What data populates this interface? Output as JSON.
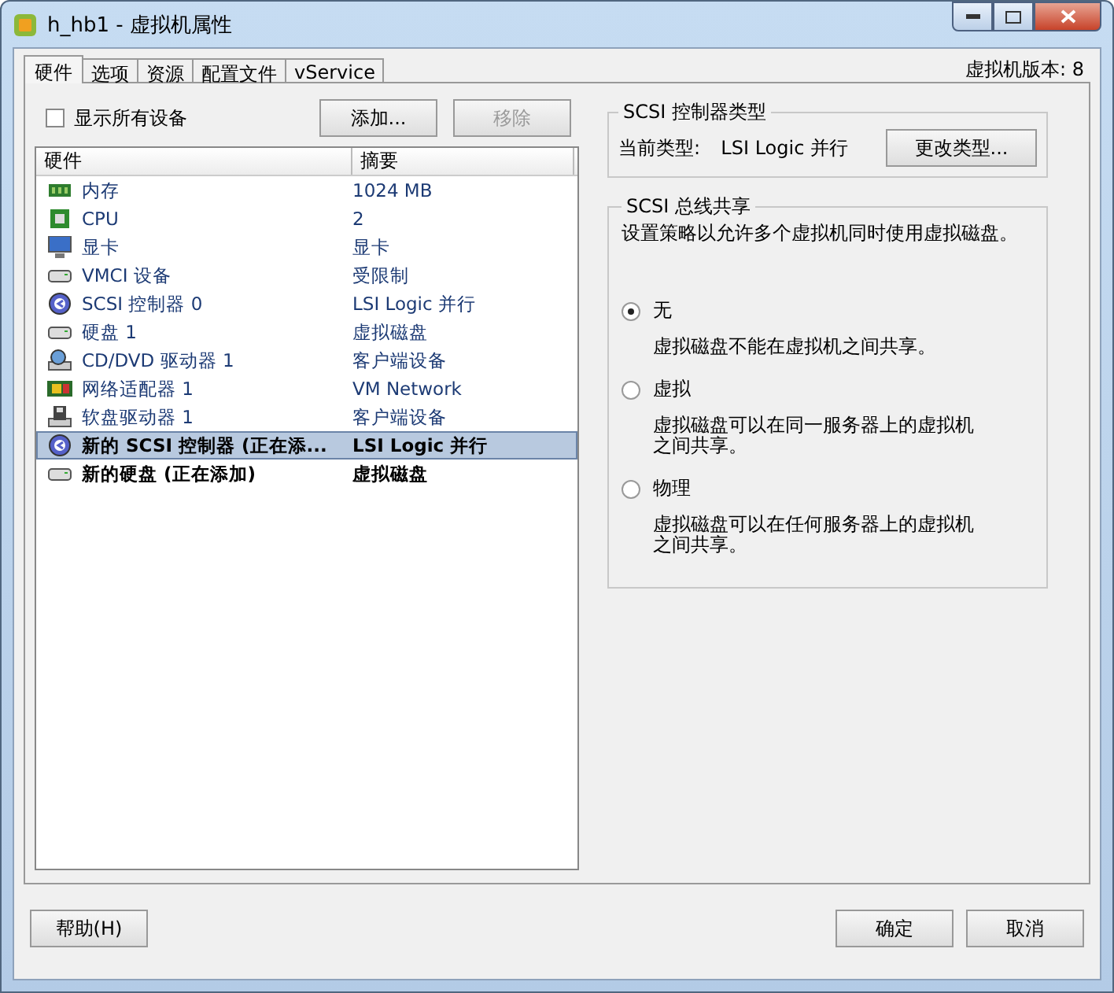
{
  "window": {
    "title": "h_hb1 - 虚拟机属性"
  },
  "tabs": [
    {
      "label": "硬件",
      "selected": true
    },
    {
      "label": "选项",
      "selected": false
    },
    {
      "label": "资源",
      "selected": false
    },
    {
      "label": "配置文件",
      "selected": false
    },
    {
      "label": "vService",
      "selected": false
    }
  ],
  "vm_version": "虚拟机版本: 8",
  "show_all": {
    "label": "显示所有设备",
    "checked": false
  },
  "add_button": {
    "label": "添加...",
    "disabled": false
  },
  "remove_button": {
    "label": "移除",
    "disabled": true
  },
  "table": {
    "columns": [
      "硬件",
      "摘要"
    ],
    "rows": [
      {
        "kind": "memory",
        "name": "内存",
        "summary": "1024 MB",
        "selected": false,
        "pending": false
      },
      {
        "kind": "cpu",
        "name": "CPU",
        "summary": "2",
        "selected": false,
        "pending": false
      },
      {
        "kind": "display",
        "name": "显卡",
        "summary": "显卡",
        "selected": false,
        "pending": false
      },
      {
        "kind": "device",
        "name": "VMCI 设备",
        "summary": "受限制",
        "selected": false,
        "pending": false
      },
      {
        "kind": "scsi",
        "name": "SCSI 控制器 0",
        "summary": "LSI Logic 并行",
        "selected": false,
        "pending": false
      },
      {
        "kind": "device",
        "name": "硬盘 1",
        "summary": "虚拟磁盘",
        "selected": false,
        "pending": false
      },
      {
        "kind": "cdrom",
        "name": "CD/DVD 驱动器 1",
        "summary": "客户端设备",
        "selected": false,
        "pending": false
      },
      {
        "kind": "network",
        "name": "网络适配器 1",
        "summary": "VM Network",
        "selected": false,
        "pending": false
      },
      {
        "kind": "floppy",
        "name": "软盘驱动器 1",
        "summary": "客户端设备",
        "selected": false,
        "pending": false
      },
      {
        "kind": "scsi",
        "name": "新的 SCSI 控制器 (正在添...",
        "summary": "LSI Logic 并行",
        "selected": true,
        "pending": true
      },
      {
        "kind": "device",
        "name": "新的硬盘 (正在添加)",
        "summary": "虚拟磁盘",
        "selected": false,
        "pending": true
      }
    ]
  },
  "controller_type": {
    "title": "SCSI 控制器类型",
    "label": "当前类型:",
    "value": "LSI Logic 并行",
    "button": "更改类型..."
  },
  "bus_sharing": {
    "title": "SCSI 总线共享",
    "description": "设置策略以允许多个虚拟机同时使用虚拟磁盘。",
    "options": [
      {
        "label": "无",
        "description": "虚拟磁盘不能在虚拟机之间共享。",
        "selected": true
      },
      {
        "label": "虚拟",
        "description": "虚拟磁盘可以在同一服务器上的虚拟机之间共享。",
        "selected": false
      },
      {
        "label": "物理",
        "description": "虚拟磁盘可以在任何服务器上的虚拟机之间共享。",
        "selected": false
      }
    ]
  },
  "footer": {
    "help": "帮助(H)",
    "ok": "确定",
    "cancel": "取消"
  }
}
